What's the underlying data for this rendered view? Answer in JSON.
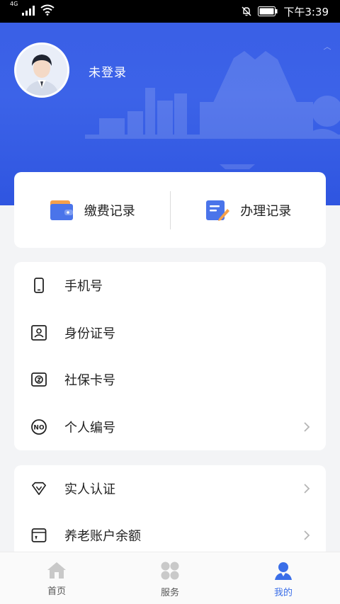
{
  "status_bar": {
    "network": "4G",
    "time": "下午3:39"
  },
  "profile": {
    "login_status": "未登录"
  },
  "records": [
    {
      "label": "缴费记录",
      "icon": "wallet-icon"
    },
    {
      "label": "办理记录",
      "icon": "document-edit-icon"
    }
  ],
  "info_list": [
    {
      "label": "手机号",
      "icon": "phone-icon",
      "chevron": false
    },
    {
      "label": "身份证号",
      "icon": "id-card-icon",
      "chevron": false
    },
    {
      "label": "社保卡号",
      "icon": "social-security-card-icon",
      "chevron": false
    },
    {
      "label": "个人编号",
      "icon": "number-badge-icon",
      "chevron": true
    }
  ],
  "service_list": [
    {
      "label": "实人认证",
      "icon": "verify-shield-icon",
      "chevron": true
    },
    {
      "label": "养老账户余额",
      "icon": "wallet-outline-icon",
      "chevron": true
    }
  ],
  "bottom_nav": [
    {
      "label": "首页",
      "icon": "home-icon",
      "active": false
    },
    {
      "label": "服务",
      "icon": "grid-icon",
      "active": false
    },
    {
      "label": "我的",
      "icon": "user-icon",
      "active": true
    }
  ],
  "colors": {
    "banner": "#3a5fe6",
    "accent": "#3a6ee8",
    "wallet_orange": "#f5a04a",
    "icon_blue": "#4a74ea"
  }
}
